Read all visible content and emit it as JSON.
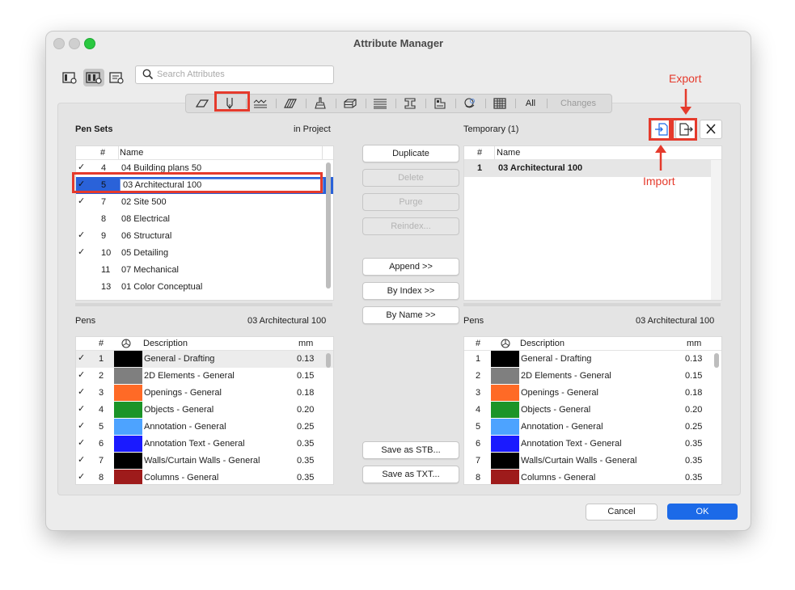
{
  "window": {
    "title": "Attribute Manager"
  },
  "search": {
    "placeholder": "Search Attributes"
  },
  "tabs": [
    {
      "icon": "surface-icon"
    },
    {
      "icon": "pen-icon"
    },
    {
      "icon": "line-type-icon"
    },
    {
      "icon": "fill-icon"
    },
    {
      "icon": "building-material-icon"
    },
    {
      "icon": "composite-icon"
    },
    {
      "icon": "profile-icon"
    },
    {
      "icon": "i-beam-icon"
    },
    {
      "icon": "zone-category-icon"
    },
    {
      "icon": "mep-system-icon"
    },
    {
      "icon": "grid-icon"
    }
  ],
  "tab_all": "All",
  "tab_changes": "Changes",
  "pen_sets": {
    "title": "Pen Sets",
    "scope": "in Project",
    "col_num": "#",
    "col_name": "Name",
    "edit_value": "03 Architectural 100",
    "rows": [
      {
        "check": "✓",
        "num": "4",
        "name": "04 Building plans 50"
      },
      {
        "check": "✓",
        "num": "5",
        "name": "03 Architectural 100"
      },
      {
        "check": "✓",
        "num": "7",
        "name": "02 Site 500"
      },
      {
        "check": "",
        "num": "8",
        "name": "08 Electrical"
      },
      {
        "check": "✓",
        "num": "9",
        "name": "06 Structural"
      },
      {
        "check": "✓",
        "num": "10",
        "name": "05 Detailing"
      },
      {
        "check": "",
        "num": "11",
        "name": "07 Mechanical"
      },
      {
        "check": "",
        "num": "13",
        "name": "01 Color Conceptual"
      }
    ]
  },
  "buttons": {
    "duplicate": "Duplicate",
    "delete": "Delete",
    "purge": "Purge",
    "reindex": "Reindex...",
    "append": "Append >>",
    "by_index": "By Index >>",
    "by_name": "By Name >>",
    "save_stb": "Save as STB...",
    "save_txt": "Save as TXT...",
    "cancel": "Cancel",
    "ok": "OK"
  },
  "temporary": {
    "title": "Temporary (1)",
    "col_num": "#",
    "col_name": "Name",
    "rows": [
      {
        "num": "1",
        "name": "03 Architectural 100"
      }
    ]
  },
  "pens_left": {
    "title": "Pens",
    "set_name": "03 Architectural 100",
    "col_num": "#",
    "col_desc": "Description",
    "col_mm": "mm",
    "rows": [
      {
        "check": "✓",
        "num": "1",
        "color": "#000000",
        "desc": "General - Drafting",
        "mm": "0.13"
      },
      {
        "check": "✓",
        "num": "2",
        "color": "#7f7f7f",
        "desc": "2D Elements - General",
        "mm": "0.15"
      },
      {
        "check": "✓",
        "num": "3",
        "color": "#ff6a26",
        "desc": "Openings - General",
        "mm": "0.18"
      },
      {
        "check": "✓",
        "num": "4",
        "color": "#1b9428",
        "desc": "Objects - General",
        "mm": "0.20"
      },
      {
        "check": "✓",
        "num": "5",
        "color": "#4da3ff",
        "desc": "Annotation - General",
        "mm": "0.25"
      },
      {
        "check": "✓",
        "num": "6",
        "color": "#1a1aff",
        "desc": "Annotation Text  - General",
        "mm": "0.35"
      },
      {
        "check": "✓",
        "num": "7",
        "color": "#000000",
        "desc": "Walls/Curtain Walls - General",
        "mm": "0.35"
      },
      {
        "check": "✓",
        "num": "8",
        "color": "#9e1b1b",
        "desc": "Columns - General",
        "mm": "0.35"
      }
    ]
  },
  "pens_right": {
    "title": "Pens",
    "set_name": "03 Architectural 100",
    "col_num": "#",
    "col_desc": "Description",
    "col_mm": "mm",
    "rows": [
      {
        "num": "1",
        "color": "#000000",
        "desc": "General - Drafting",
        "mm": "0.13"
      },
      {
        "num": "2",
        "color": "#7f7f7f",
        "desc": "2D Elements - General",
        "mm": "0.15"
      },
      {
        "num": "3",
        "color": "#ff6a26",
        "desc": "Openings - General",
        "mm": "0.18"
      },
      {
        "num": "4",
        "color": "#1b9428",
        "desc": "Objects - General",
        "mm": "0.20"
      },
      {
        "num": "5",
        "color": "#4da3ff",
        "desc": "Annotation - General",
        "mm": "0.25"
      },
      {
        "num": "6",
        "color": "#1a1aff",
        "desc": "Annotation Text  - General",
        "mm": "0.35"
      },
      {
        "num": "7",
        "color": "#000000",
        "desc": "Walls/Curtain Walls - General",
        "mm": "0.35"
      },
      {
        "num": "8",
        "color": "#9e1b1b",
        "desc": "Columns - General",
        "mm": "0.35"
      }
    ]
  },
  "annotations": {
    "export": "Export",
    "import": "Import"
  },
  "colors": {
    "accent": "#1c6ae8",
    "selection": "#2a62d9",
    "highlight": "#e53a2c"
  }
}
